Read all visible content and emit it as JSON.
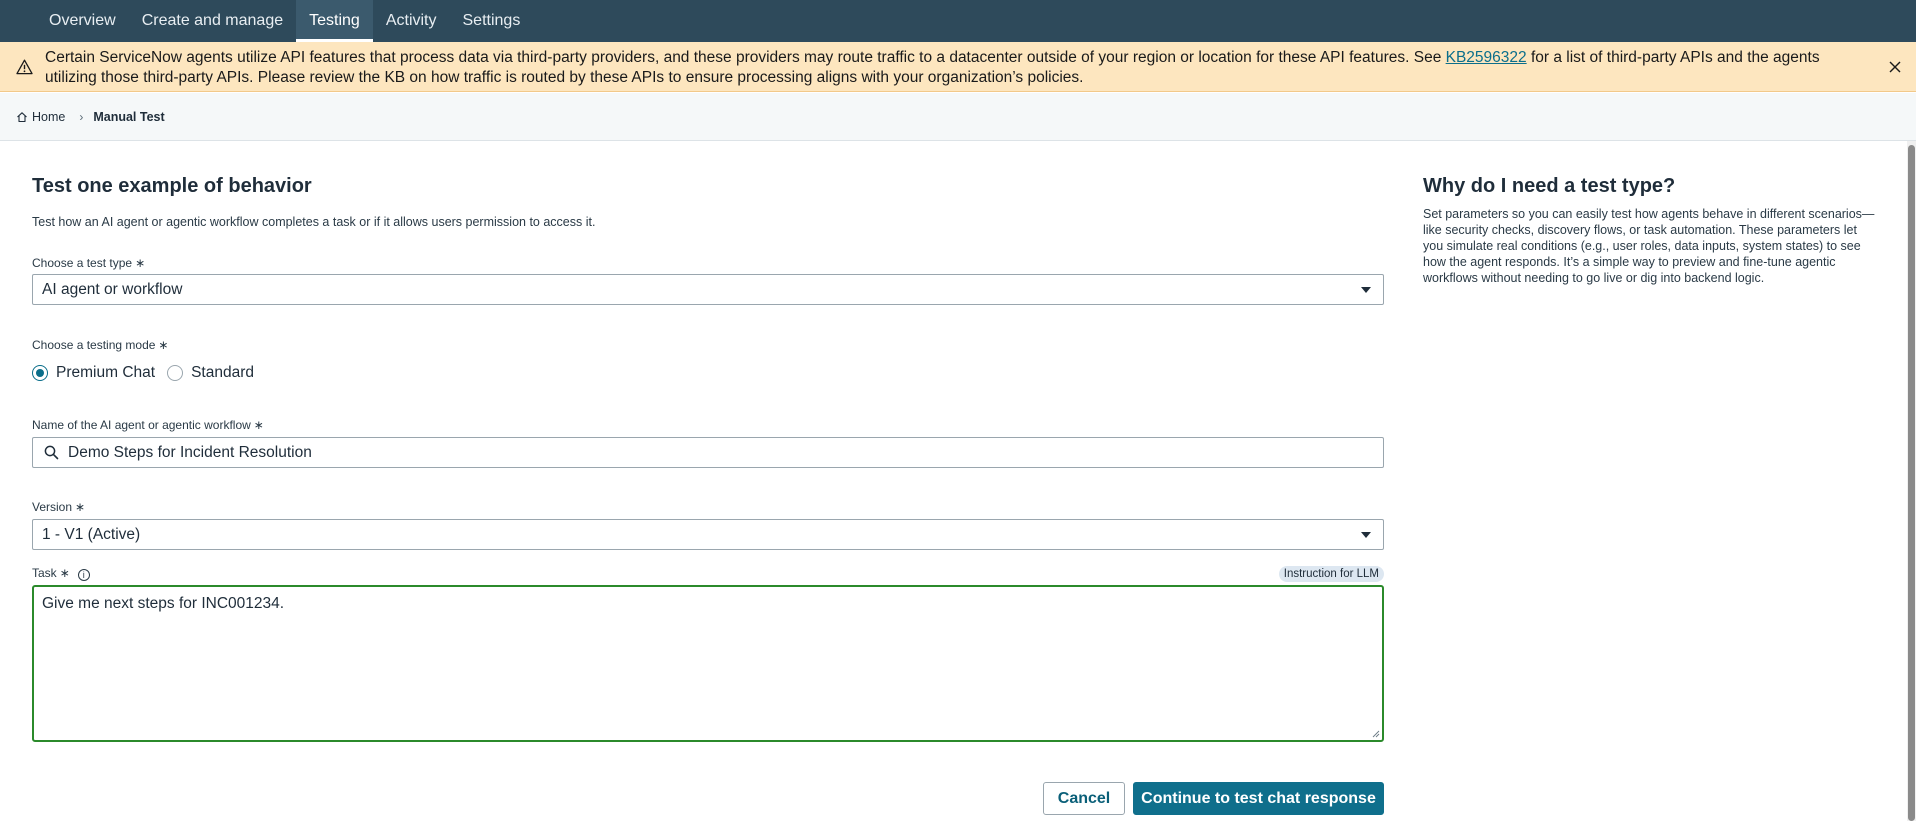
{
  "nav": {
    "tabs": [
      {
        "label": "Overview"
      },
      {
        "label": "Create and manage"
      },
      {
        "label": "Testing"
      },
      {
        "label": "Activity"
      },
      {
        "label": "Settings"
      }
    ],
    "active_tab": "Testing"
  },
  "banner": {
    "text_before": "Certain ServiceNow agents utilize API features that process data via third-party providers, and these providers may route traffic to a datacenter outside of your region or location for these API features. See ",
    "link_text": "KB2596322",
    "text_after": " for a list of third-party APIs and the agents utilizing those third-party APIs. Please review the KB on how traffic is routed by these APIs to ensure processing aligns with your organization’s policies.",
    "close_icon": "close-icon",
    "warning_icon": "warning-triangle-icon"
  },
  "breadcrumb": {
    "home": "Home",
    "current": "Manual Test"
  },
  "form": {
    "title": "Test one example of behavior",
    "description": "Test how an AI agent or agentic workflow completes a task or if it allows users permission to access it.",
    "test_type": {
      "label": "Choose a test type",
      "required_mark": "∗",
      "value": "AI agent or workflow"
    },
    "testing_mode": {
      "label": "Choose a testing mode",
      "required_mark": "∗",
      "options": [
        {
          "label": "Premium Chat",
          "checked": true
        },
        {
          "label": "Standard",
          "checked": false
        }
      ]
    },
    "agent_name": {
      "label": "Name of the AI agent or agentic workflow",
      "required_mark": "∗",
      "value": "Demo Steps for Incident Resolution"
    },
    "version": {
      "label": "Version",
      "required_mark": "∗",
      "value": "1 - V1 (Active)"
    },
    "task": {
      "label": "Task",
      "required_mark": "∗",
      "badge": "Instruction for LLM",
      "value": "Give me next steps for INC001234.",
      "info_glyph": "i"
    },
    "cancel_label": "Cancel",
    "continue_label": "Continue to test chat response"
  },
  "side_panel": {
    "title": "Why do I need a test type?",
    "body": "Set parameters so you can easily test how agents behave in different scenarios—like security checks, discovery flows, or task automation. These parameters let you simulate real conditions (e.g., user roles, data inputs, system states) to see how the agent responds. It’s a simple way to preview and fine-tune agentic workflows without needing to go live or dig into backend logic."
  },
  "colors": {
    "nav_bg": "#2e4a5b",
    "banner_bg": "#fde6bf",
    "primary": "#0f6f8c",
    "focus_border": "#2b8a2b"
  }
}
